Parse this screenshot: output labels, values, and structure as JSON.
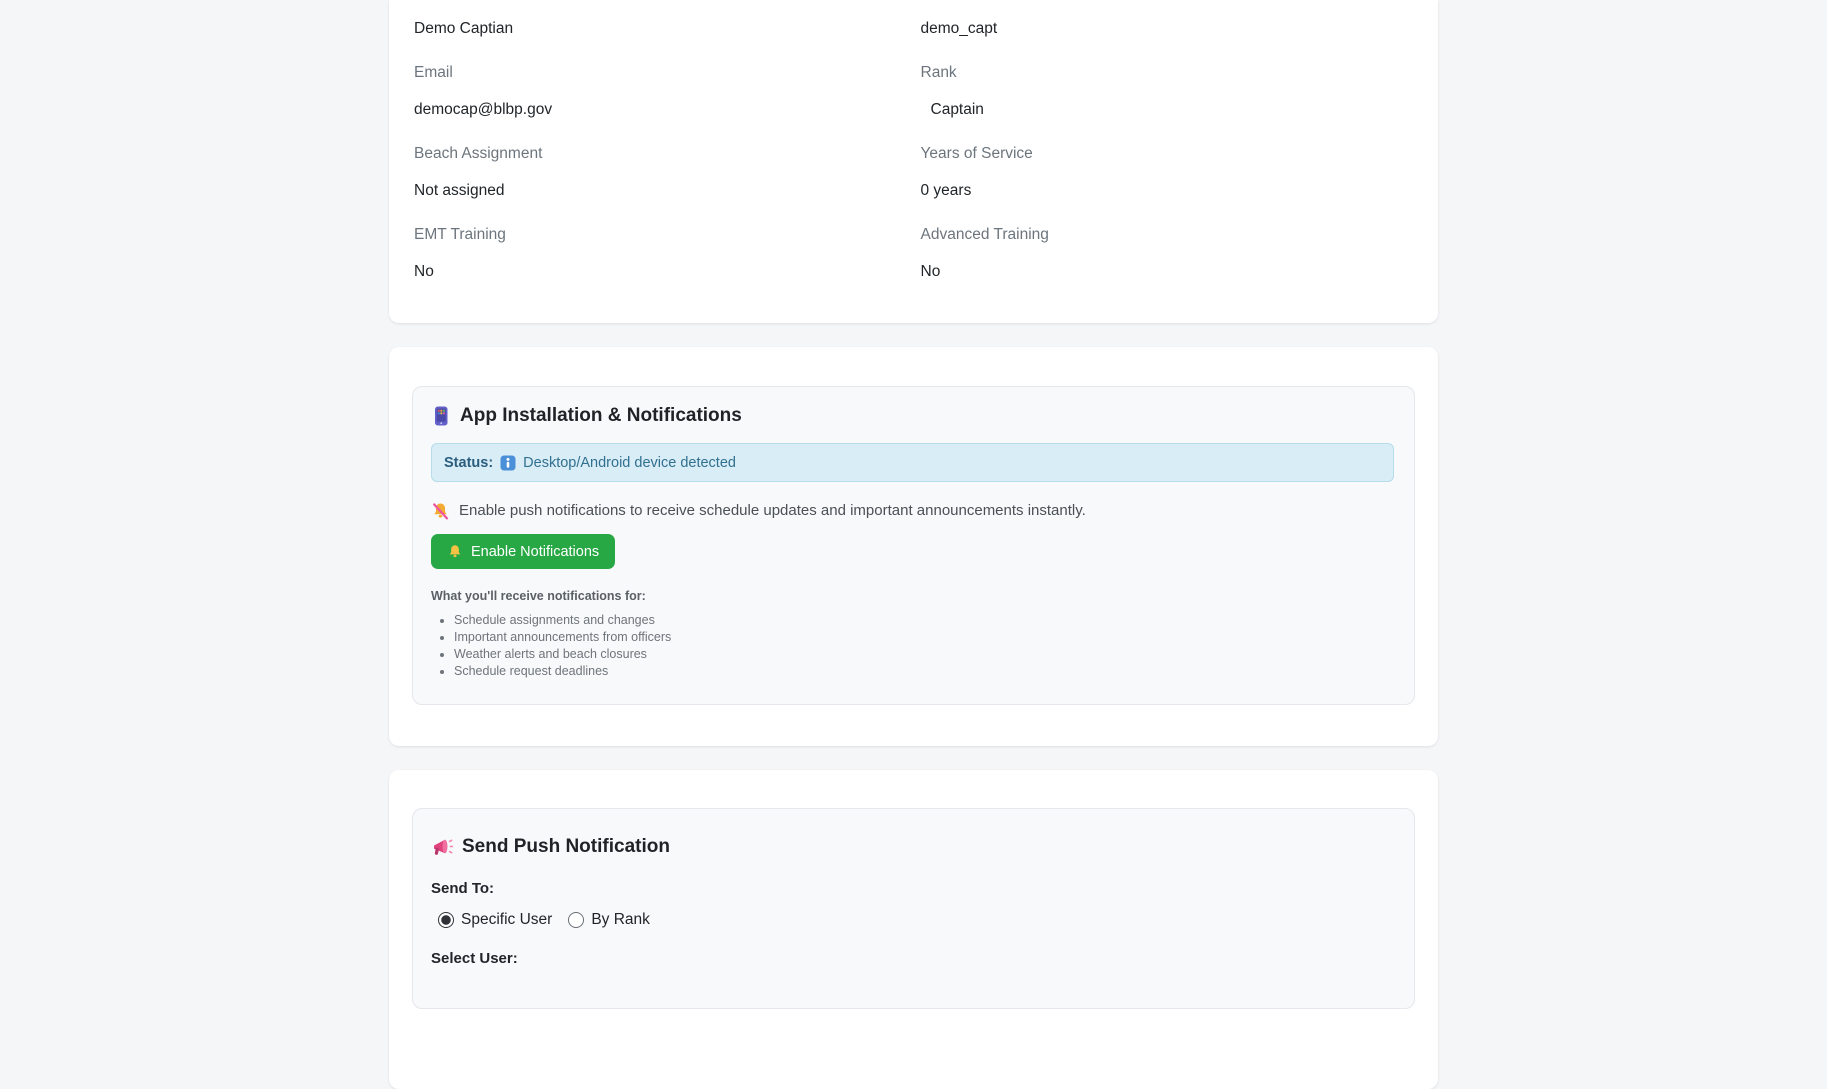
{
  "colors": {
    "page_bg": "#f5f6f8",
    "card_bg": "#ffffff",
    "panel_bg": "#f8f9fa",
    "panel_border": "#e4e7eb",
    "label_gray": "#6c757d",
    "text_dark": "#212529",
    "status_bg": "#d9edf7",
    "status_border": "#b7dcec",
    "status_text": "#31708f",
    "button_green": "#28a745",
    "button_text": "#ffffff"
  },
  "profile_card": {
    "left_column": [
      {
        "value": "Demo Captian"
      },
      {
        "label": "Email",
        "value": "democap@blbp.gov"
      },
      {
        "label": "Beach Assignment",
        "value": "Not assigned"
      },
      {
        "label": "EMT Training",
        "value": "No"
      }
    ],
    "right_column": [
      {
        "value": "demo_capt"
      },
      {
        "label": "Rank",
        "value": "Captain"
      },
      {
        "label": "Years of Service",
        "value": "0 years"
      },
      {
        "label": "Advanced Training",
        "value": "No"
      }
    ]
  },
  "app_card": {
    "icon": "mobile-phone-icon",
    "title": "App Installation & Notifications",
    "status": {
      "label": "Status:",
      "icon": "info-icon",
      "text": "Desktop/Android device detected"
    },
    "description": {
      "icon": "bell-slash-icon",
      "text": "Enable push notifications to receive schedule updates and important announcements instantly."
    },
    "enable_button": {
      "icon": "bell-icon",
      "label": "Enable Notifications"
    },
    "list_heading": "What you'll receive notifications for:",
    "list_items": [
      "Schedule assignments and changes",
      "Important announcements from officers",
      "Weather alerts and beach closures",
      "Schedule request deadlines"
    ]
  },
  "push_card": {
    "icon": "megaphone-icon",
    "title": "Send Push Notification",
    "send_to_label": "Send To:",
    "radio_options": [
      {
        "label": "Specific User",
        "selected": true
      },
      {
        "label": "By Rank",
        "selected": false
      }
    ],
    "select_user_label": "Select User:"
  }
}
